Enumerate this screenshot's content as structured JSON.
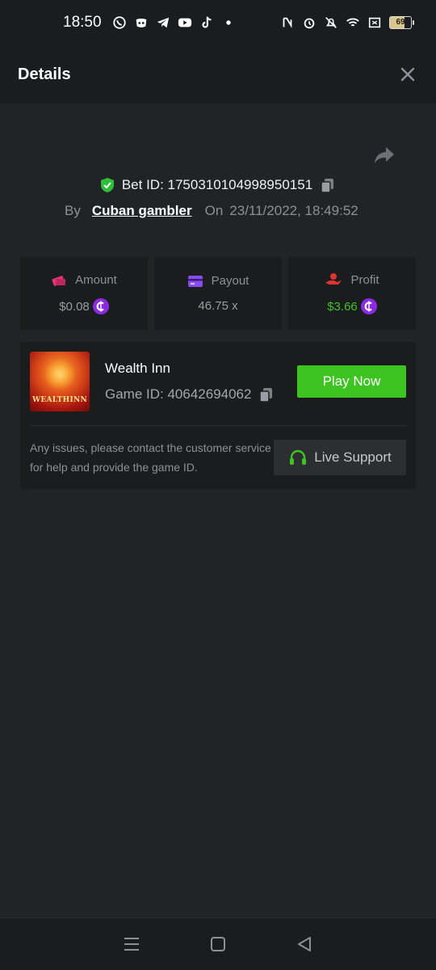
{
  "status_bar": {
    "time": "18:50",
    "battery": "69",
    "icons": [
      "whatsapp-icon",
      "discord-icon",
      "telegram-icon",
      "youtube-icon",
      "tiktok-icon",
      "dot-icon",
      "nfc-icon",
      "alarm-icon",
      "mute-icon",
      "wifi-icon",
      "screen-icon",
      "battery-icon"
    ]
  },
  "header": {
    "title": "Details"
  },
  "bet": {
    "bet_id_text": "Bet ID: 1750310104998950151",
    "by_label": "By",
    "username": "Cuban gambler",
    "on_label": "On",
    "datetime": "23/11/2022, 18:49:52"
  },
  "stats": {
    "amount": {
      "label": "Amount",
      "value": "$0.08"
    },
    "payout": {
      "label": "Payout",
      "value": "46.75 x"
    },
    "profit": {
      "label": "Profit",
      "value": "$3.66"
    }
  },
  "game": {
    "thumb_text": "WEALTHINN",
    "name": "Wealth Inn",
    "game_id_text": "Game ID: 40642694062",
    "play_label": "Play Now",
    "support_text": "Any issues, please contact the customer service for help and provide the game ID.",
    "support_label": "Live Support"
  },
  "colors": {
    "accent_green": "#3dc421",
    "coin_purple": "#8a2be2",
    "amount_pink": "#e0357a",
    "payout_purple": "#8a4cf0",
    "profit_red": "#e2342f"
  }
}
